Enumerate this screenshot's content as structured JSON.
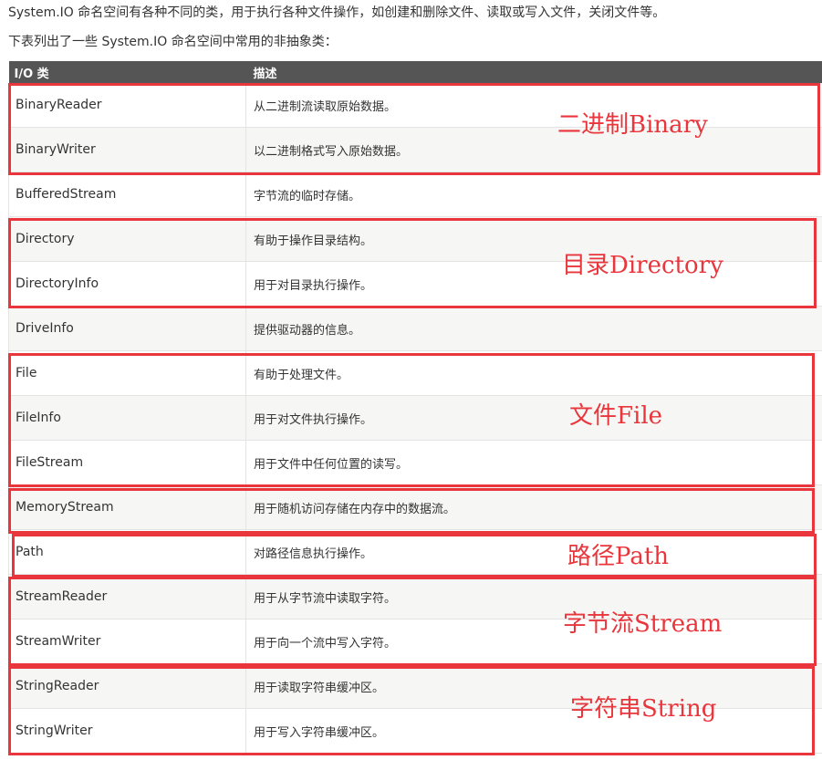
{
  "intro": {
    "line1": "System.IO 命名空间有各种不同的类，用于执行各种文件操作，如创建和删除文件、读取或写入文件，关闭文件等。",
    "line2": "下表列出了一些 System.IO 命名空间中常用的非抽象类："
  },
  "table": {
    "headers": [
      "I/O 类",
      "描述"
    ],
    "rows": [
      {
        "cls": "BinaryReader",
        "desc": "从二进制流读取原始数据。"
      },
      {
        "cls": "BinaryWriter",
        "desc": "以二进制格式写入原始数据。"
      },
      {
        "cls": "BufferedStream",
        "desc": "字节流的临时存储。"
      },
      {
        "cls": "Directory",
        "desc": "有助于操作目录结构。"
      },
      {
        "cls": "DirectoryInfo",
        "desc": "用于对目录执行操作。"
      },
      {
        "cls": "DriveInfo",
        "desc": "提供驱动器的信息。"
      },
      {
        "cls": "File",
        "desc": "有助于处理文件。"
      },
      {
        "cls": "FileInfo",
        "desc": "用于对文件执行操作。"
      },
      {
        "cls": "FileStream",
        "desc": "用于文件中任何位置的读写。"
      },
      {
        "cls": "MemoryStream",
        "desc": "用于随机访问存储在内存中的数据流。"
      },
      {
        "cls": "Path",
        "desc": "对路径信息执行操作。"
      },
      {
        "cls": "StreamReader",
        "desc": "用于从字节流中读取字符。"
      },
      {
        "cls": "StreamWriter",
        "desc": "用于向一个流中写入字符。"
      },
      {
        "cls": "StringReader",
        "desc": "用于读取字符串缓冲区。"
      },
      {
        "cls": "StringWriter",
        "desc": "用于写入字符串缓冲区。"
      }
    ]
  },
  "annotations": {
    "binary": "二进制Binary",
    "directory": "目录Directory",
    "file": "文件File",
    "path": "路径Path",
    "stream": "字节流Stream",
    "string": "字符串String",
    "color": "#e8363c"
  }
}
